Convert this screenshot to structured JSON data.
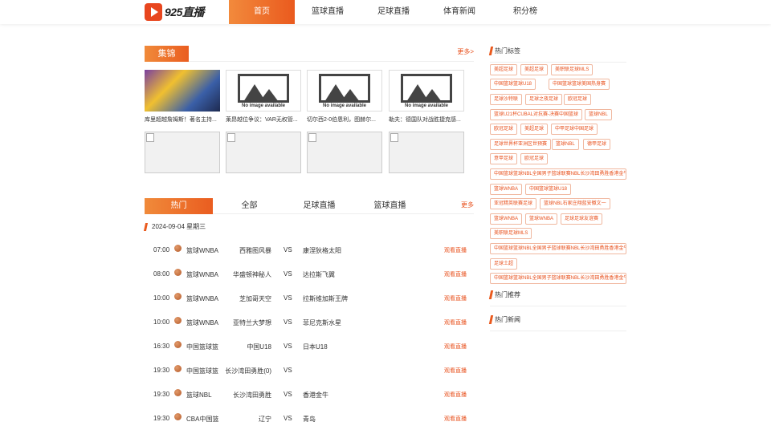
{
  "header": {
    "logo_text": "925直播",
    "nav": [
      "首页",
      "篮球直播",
      "足球直播",
      "体育新闻",
      "积分榜"
    ]
  },
  "highlights": {
    "label": "集锦",
    "more": "更多>",
    "no_image_caption": "No image available",
    "items": [
      {
        "title": "库里超越詹姆斯！著名主持..."
      },
      {
        "title": "莱昂越位争议：VAR无权管..."
      },
      {
        "title": "切尔西2-0伯恩利，图赫尔..."
      },
      {
        "title": "勒夫：德国队对战胜捷克感..."
      }
    ]
  },
  "schedule": {
    "tabs": [
      "热门",
      "全部",
      "足球直播",
      "篮球直播"
    ],
    "more": "更多",
    "date": "2024-09-04 星期三",
    "vs": "VS",
    "link_label": "观看直播",
    "matches": [
      {
        "time": "07:00",
        "league": "篮球WNBA",
        "home": "西雅图风暴",
        "away": "康涅狄格太阳"
      },
      {
        "time": "08:00",
        "league": "篮球WNBA",
        "home": "华盛顿神秘人",
        "away": "达拉斯飞翼"
      },
      {
        "time": "10:00",
        "league": "篮球WNBA",
        "home": "芝加哥天空",
        "away": "拉斯维加斯王牌"
      },
      {
        "time": "10:00",
        "league": "篮球WNBA",
        "home": "亚特兰大梦想",
        "away": "菲尼克斯水星"
      },
      {
        "time": "16:30",
        "league": "中国篮球篮",
        "home": "中国U18",
        "away": "日本U18"
      },
      {
        "time": "19:30",
        "league": "中国篮球篮",
        "home": "长沙湾田勇胜(0)",
        "away": ""
      },
      {
        "time": "19:30",
        "league": "篮球NBL",
        "home": "长沙湾田勇胜",
        "away": "香港金牛"
      },
      {
        "time": "19:30",
        "league": "CBA中国篮",
        "home": "辽宁",
        "away": "青岛"
      }
    ]
  },
  "sidebar": {
    "hot_tags_title": "热门标签",
    "hot_recommend_title": "热门推荐",
    "hot_news_title": "热门新闻",
    "tags": [
      "美超足球",
      "美超足球",
      "美职联足球MLS",
      "中国篮球篮球U18",
      "中国篮球篮球美国热身赛",
      "足球沙特联",
      "足球之夜足球",
      "欧冠足球",
      "篮球U21杯CUBAL对抗赛-决赛中国篮球",
      "篮球NBL",
      "欧冠足球",
      "美超足球",
      "中甲足球中国足球",
      "足球世界杯亚洲区世预赛",
      "篮球NBL",
      "德甲足球",
      "意甲足球",
      "欧冠足球",
      "中国篮球篮球NBL全国男子篮球联赛NBL长沙湾田勇胜香港金牛",
      "篮球WNBA",
      "中国篮球篮球U18",
      "亚冠精英联赛足球",
      "篮球NBL石家庄翔蓝安徽文一",
      "篮球WNBA",
      "篮球WNBA",
      "足球足球友谊赛",
      "美职联足球MLS",
      "中国篮球篮球NBL全国男子篮球联赛NBL长沙湾田勇胜香港金牛",
      "足球土超",
      "中国篮球篮球NBL全国男子篮球联赛NBL长沙湾田勇胜香港金牛"
    ]
  }
}
